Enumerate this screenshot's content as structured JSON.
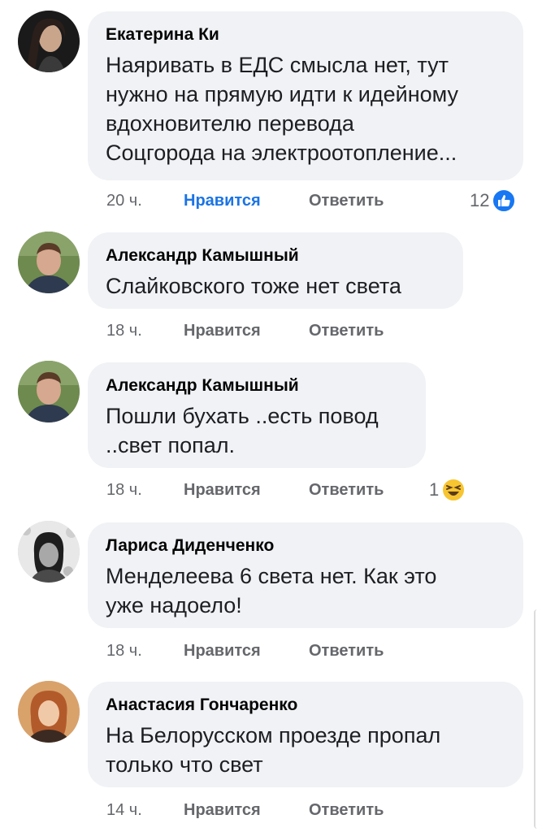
{
  "colors": {
    "bubble_bg": "#f0f2f5",
    "action_grey": "#65676b",
    "like_blue": "#1b74e4",
    "name_black": "#050505"
  },
  "comments": [
    {
      "author": "Екатерина Ки",
      "text_lines": [
        "Наяривать в ЕДС смысла нет, тут",
        "нужно на прямую идти к идейному",
        "вдохновителю перевода",
        "Соцгорода на электроотопление..."
      ],
      "time": "20 ч.",
      "like_label": "Нравится",
      "like_active": true,
      "reply_label": "Ответить",
      "reaction_count": "12",
      "reaction_icon": "like-icon"
    },
    {
      "author": "Александр Камышный",
      "text_lines": [
        "Слайковского тоже нет света"
      ],
      "time": "18 ч.",
      "like_label": "Нравится",
      "like_active": false,
      "reply_label": "Ответить"
    },
    {
      "author": "Александр Камышный",
      "text_lines": [
        "Пошли бухать ..есть повод",
        "..свет попал."
      ],
      "time": "18 ч.",
      "like_label": "Нравится",
      "like_active": false,
      "reply_label": "Ответить",
      "reaction_count": "1",
      "reaction_icon": "laughing-emoji-icon"
    },
    {
      "author": "Лариса Диденченко",
      "text_lines": [
        "Менделеева 6 света нет. Как это",
        "уже надоело!"
      ],
      "time": "18 ч.",
      "like_label": "Нравится",
      "like_active": false,
      "reply_label": "Ответить"
    },
    {
      "author": "Анастасия Гончаренко",
      "text_lines": [
        "На Белорусском проезде пропал",
        "только что свет"
      ],
      "time": "14 ч.",
      "like_label": "Нравится",
      "like_active": false,
      "reply_label": "Ответить"
    }
  ]
}
